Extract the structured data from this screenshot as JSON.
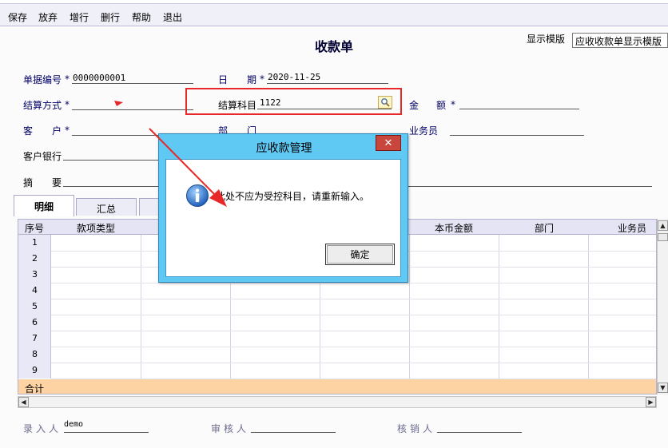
{
  "menu": [
    "保存",
    "放弃",
    "增行",
    "删行",
    "帮助",
    "退出"
  ],
  "title": "收款单",
  "template": {
    "label": "显示模版",
    "selected": "应收收款单显示模版"
  },
  "form": {
    "doc_no_label": "单据编号",
    "doc_no_value": "0000000001",
    "date_label_1": "日",
    "date_label_2": "期",
    "date_value": "2020-11-25",
    "settle_method_label": "结算方式",
    "settle_account_label": "结算科目",
    "settle_account_value": "1122",
    "amount_label_1": "金",
    "amount_label_2": "额",
    "customer_label_1": "客",
    "customer_label_2": "户",
    "dept_label_1": "部",
    "dept_label_2": "门",
    "salesman_label": "业务员",
    "bank_label": "客户银行",
    "summary_label_1": "摘",
    "summary_label_2": "要",
    "required_mark": "*"
  },
  "tabs": [
    "明细",
    "汇总"
  ],
  "grid": {
    "headers": [
      "序号",
      "款项类型",
      "本币金额",
      "部门",
      "业务员"
    ],
    "rows": [
      "1",
      "2",
      "3",
      "4",
      "5",
      "6",
      "7",
      "8",
      "9"
    ],
    "sum_label": "合计"
  },
  "footer": {
    "entry_label": "录入人",
    "entry_value": "demo",
    "review_label": "审核人",
    "writeoff_label": "核销人"
  },
  "dialog": {
    "title": "应收款管理",
    "close": "✕",
    "message": "此处不应为受控科目，请重新输入。",
    "ok": "确定"
  },
  "colors": {
    "annotation": "#e82828",
    "dialog_frame": "#5fc9f4",
    "sum_row": "#fdd3a4",
    "grid_header": "#e4e4f4"
  },
  "icons": {
    "lookup": "magnifier-icon",
    "info": "info-icon",
    "close": "close-icon"
  }
}
